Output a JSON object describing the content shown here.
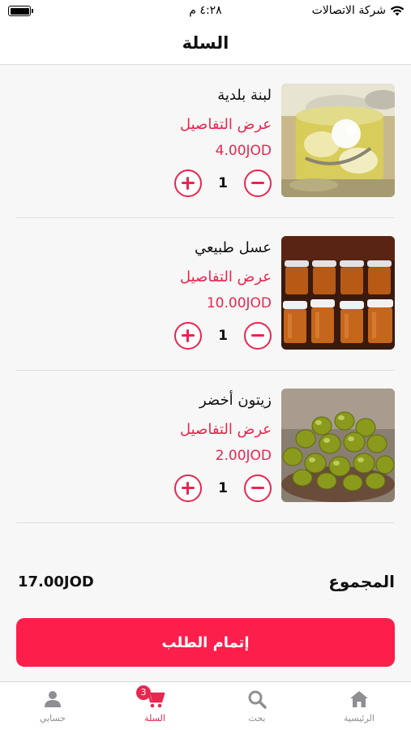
{
  "status_bar": {
    "carrier": "شركة الاتصالات",
    "time": "٤:٢٨ م"
  },
  "header": {
    "title": "السلة"
  },
  "cart": {
    "details_label": "عرض التفاصيل",
    "items": [
      {
        "name": "لبنة بلدية",
        "price": "4.00JOD",
        "quantity": "1"
      },
      {
        "name": "عسل طبيعي",
        "price": "10.00JOD",
        "quantity": "1"
      },
      {
        "name": "زيتون أخضر",
        "price": "2.00JOD",
        "quantity": "1"
      }
    ]
  },
  "total": {
    "label": "المجموع",
    "value": "17.00JOD"
  },
  "checkout": {
    "label": "إتمام الطلب"
  },
  "tab_bar": {
    "tabs": [
      {
        "label": "الرئيسية",
        "icon": "home-icon",
        "active": false
      },
      {
        "label": "بحث",
        "icon": "search-icon",
        "active": false
      },
      {
        "label": "السلة",
        "icon": "cart-icon",
        "active": true,
        "badge": "3"
      },
      {
        "label": "حسابي",
        "icon": "person-icon",
        "active": false
      }
    ]
  },
  "colors": {
    "accent": "#e8264f",
    "button": "#fc1e4b",
    "inactive": "#8e8e93"
  }
}
